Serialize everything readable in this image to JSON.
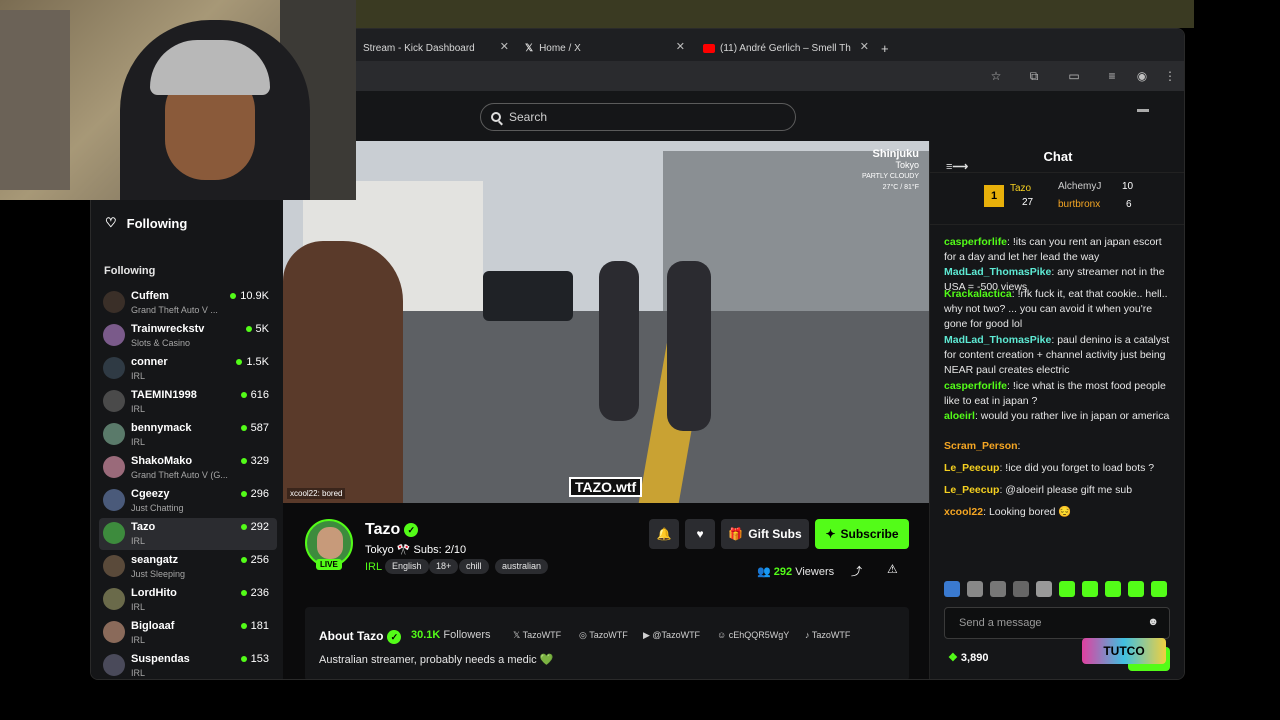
{
  "browser": {
    "tabs": [
      {
        "label": "Stream - Kick Dashboard"
      },
      {
        "label": "Home / X"
      },
      {
        "label": "(11) André Gerlich – Smell Th"
      }
    ],
    "add_tab": "+"
  },
  "header": {
    "search_placeholder": "Search"
  },
  "sidebar": {
    "following_heading": "Following",
    "following_section": "Following",
    "channels": [
      {
        "name": "Cuffem",
        "category": "Grand Theft Auto V ...",
        "viewers": "10.9K"
      },
      {
        "name": "Trainwreckstv",
        "category": "Slots & Casino",
        "viewers": "5K"
      },
      {
        "name": "conner",
        "category": "IRL",
        "viewers": "1.5K"
      },
      {
        "name": "TAEMIN1998",
        "category": "IRL",
        "viewers": "616"
      },
      {
        "name": "bennymack",
        "category": "IRL",
        "viewers": "587"
      },
      {
        "name": "ShakoMako",
        "category": "Grand Theft Auto V (G...",
        "viewers": "329"
      },
      {
        "name": "Cgeezy",
        "category": "Just Chatting",
        "viewers": "296"
      },
      {
        "name": "Tazo",
        "category": "IRL",
        "viewers": "292"
      },
      {
        "name": "seangatz",
        "category": "Just Sleeping",
        "viewers": "256"
      },
      {
        "name": "LordHito",
        "category": "IRL",
        "viewers": "236"
      },
      {
        "name": "Bigloaaf",
        "category": "IRL",
        "viewers": "181"
      },
      {
        "name": "Suspendas",
        "category": "IRL",
        "viewers": "153"
      }
    ]
  },
  "video": {
    "location_city": "Shinjuku",
    "location_region": "Tokyo",
    "weather": "PARTLY CLOUDY",
    "temperature": "27°C / 81°F",
    "overlay_chat": "xcool22: bored",
    "watermark": "TAZO.wtf"
  },
  "channel": {
    "name": "Tazo",
    "title": "Tokyo 🎌 Subs: 2/10",
    "live_badge": "LIVE",
    "category": "IRL",
    "tags": [
      "English",
      "18+",
      "chill",
      "australian"
    ],
    "gift_label": "Gift Subs",
    "subscribe_label": "Subscribe",
    "viewers": "292",
    "viewers_label": "Viewers",
    "about_title": "About Tazo",
    "followers": "30.1K",
    "followers_label": "Followers",
    "bio": "Australian streamer, probably needs a medic 💚",
    "socials": [
      "TazoWTF",
      "TazoWTF",
      "@TazoWTF",
      "cEhQQR5WgY",
      "TazoWTF"
    ]
  },
  "chat": {
    "title": "Chat",
    "gifters": [
      {
        "rank": "1",
        "name": "Tazo",
        "count": "27"
      },
      {
        "name": "AlchemyJ",
        "count": "10"
      },
      {
        "name": "burtbronx",
        "count": "6"
      }
    ],
    "messages": [
      {
        "user": "casperforlife",
        "text": "!its can you rent an japan escort for a day and let her lead the way",
        "color": "#53fc18"
      },
      {
        "user": "MadLad_ThomasPike",
        "text": "any streamer not in the USA = -500 views",
        "color": "#5eead4"
      },
      {
        "user": "Krackalactica",
        "text": "!rfk fuck it, eat that cookie.. hell.. why not two? ... you can avoid it when you're gone for good lol",
        "color": "#53fc18"
      },
      {
        "user": "MadLad_ThomasPike",
        "text": "paul denino is a catalyst for content creation + channel activity just being NEAR paul creates electric",
        "color": "#5eead4"
      },
      {
        "user": "casperforlife",
        "text": "!ice what is the most food people like to eat in japan ?",
        "color": "#53fc18"
      },
      {
        "user": "aloeirl",
        "text": "would you rather live in japan or america",
        "color": "#53fc18"
      },
      {
        "user": "Scram_Person",
        "text": "",
        "color": "#f5a623"
      },
      {
        "user": "Le_Peecup",
        "text": "!ice did you forget to load bots ?",
        "color": "#f5d020"
      },
      {
        "user": "Le_Peecup",
        "text": "@aloeirl please gift me sub",
        "color": "#f5d020"
      },
      {
        "user": "xcool22",
        "text": "Looking bored 😔",
        "color": "#f5a623"
      }
    ],
    "input_placeholder": "Send a message",
    "points": "3,890"
  },
  "branding": {
    "logo_text": "TUTCO"
  },
  "colors": {
    "accent": "#53fc18",
    "bg": "#0b0b0c",
    "panel": "#151618"
  }
}
